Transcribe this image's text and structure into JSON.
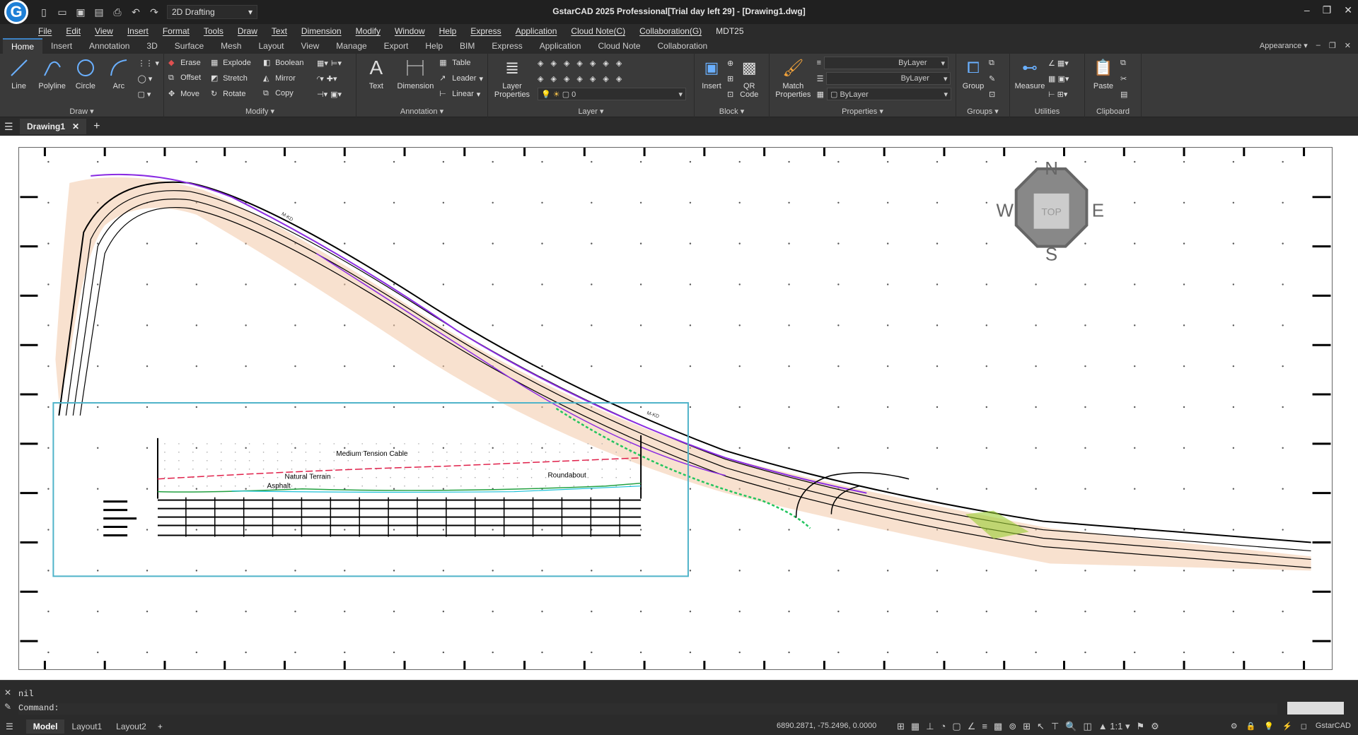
{
  "window": {
    "title": "GstarCAD 2025 Professional[Trial day left 29] - [Drawing1.dwg]",
    "workspace": "2D Drafting"
  },
  "menu": [
    "File",
    "Edit",
    "View",
    "Insert",
    "Format",
    "Tools",
    "Draw",
    "Text",
    "Dimension",
    "Modify",
    "Window",
    "Help",
    "Express",
    "Application",
    "Cloud Note(C)",
    "Collaboration(G)",
    "MDT25"
  ],
  "ribbon_tabs": [
    "Home",
    "Insert",
    "Annotation",
    "3D",
    "Surface",
    "Mesh",
    "Layout",
    "View",
    "Manage",
    "Export",
    "Help",
    "BIM",
    "Express",
    "Application",
    "Cloud Note",
    "Collaboration"
  ],
  "appearance": "Appearance",
  "panels": {
    "draw": {
      "title": "Draw",
      "tools": [
        "Line",
        "Polyline",
        "Circle",
        "Arc"
      ]
    },
    "modify": {
      "title": "Modify",
      "row1": [
        "Erase",
        "Explode",
        "Boolean"
      ],
      "row2": [
        "Offset",
        "Stretch",
        "Mirror"
      ],
      "row3": [
        "Move",
        "Rotate",
        "Copy"
      ]
    },
    "annotation": {
      "title": "Annotation",
      "big": [
        "Text",
        "Dimension"
      ],
      "small": [
        "Table",
        "Leader",
        "Linear"
      ]
    },
    "layer": {
      "title": "Layer",
      "big": "Layer Properties",
      "current": "0"
    },
    "block": {
      "title": "Block",
      "big": [
        "Insert",
        "QR Code"
      ]
    },
    "properties": {
      "title": "Properties",
      "big": "Match Properties",
      "linetype": "ByLayer",
      "lineweight": "ByLayer",
      "color": "ByLayer"
    },
    "groups": {
      "title": "Groups",
      "big": "Group"
    },
    "utilities": {
      "title": "Utilities",
      "big": "Measure"
    },
    "clipboard": {
      "title": "Clipboard",
      "big": "Paste"
    }
  },
  "doc_tab": "Drawing1",
  "drawing": {
    "labels": [
      "Medium Tension Cable",
      "Natural Terrain",
      "Asphalt",
      "Roundabout"
    ]
  },
  "command": {
    "history": "nil",
    "prompt": "Command:"
  },
  "status": {
    "layouts": [
      "Model",
      "Layout1",
      "Layout2"
    ],
    "coords": "6890.2871, -75.2496, 0.0000",
    "scale": "1:1",
    "app": "GstarCAD"
  },
  "colors": {
    "accent": "#3d82c4",
    "road_purple": "#8a2be2",
    "terrain_orange": "#e8a070",
    "edge_green": "#22c55e",
    "cable_red": "#e0204a"
  }
}
